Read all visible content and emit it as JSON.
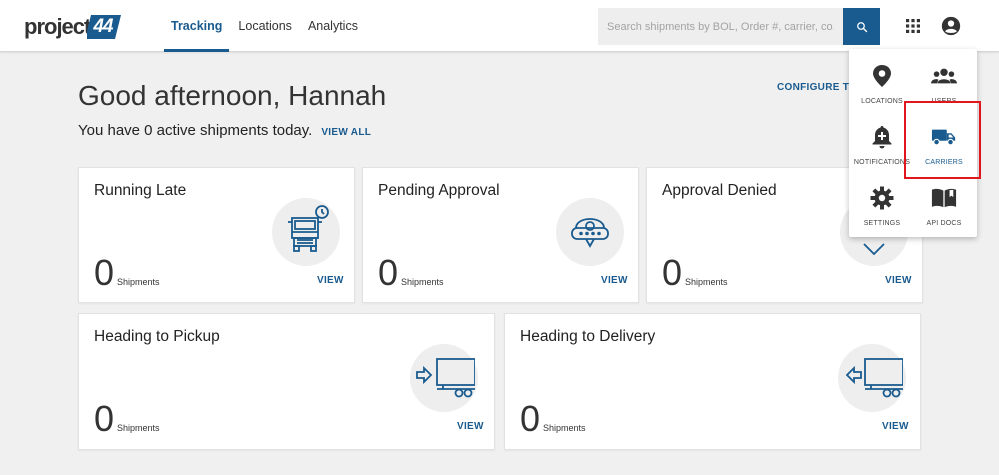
{
  "header": {
    "logo_text": "project",
    "logo_mark": "44",
    "tabs": [
      {
        "label": "Tracking",
        "active": true
      },
      {
        "label": "Locations",
        "active": false
      },
      {
        "label": "Analytics",
        "active": false
      }
    ],
    "search": {
      "placeholder": "Search shipments by BOL, Order #, carrier, co..."
    },
    "icons": {
      "search": "search-icon",
      "apps": "apps-grid-icon",
      "account": "account-icon"
    }
  },
  "main": {
    "greeting": "Good afternoon, Hannah",
    "subline": "You have 0 active shipments today.",
    "view_all": "VIEW ALL",
    "configure": "CONFIGURE TH"
  },
  "cards": [
    {
      "title": "Running Late",
      "count": "0",
      "unit": "Shipments",
      "view": "VIEW",
      "icon": "truck-clock-icon"
    },
    {
      "title": "Pending Approval",
      "count": "0",
      "unit": "Shipments",
      "view": "VIEW",
      "icon": "location-pin-icon"
    },
    {
      "title": "Approval Denied",
      "count": "0",
      "unit": "Shipments",
      "view": "VIEW",
      "icon": "location-denied-icon"
    },
    {
      "title": "Heading to Pickup",
      "count": "0",
      "unit": "Shipments",
      "view": "VIEW",
      "icon": "truck-pickup-icon"
    },
    {
      "title": "Heading to Delivery",
      "count": "0",
      "unit": "Shipments",
      "view": "VIEW",
      "icon": "truck-delivery-icon"
    }
  ],
  "apps_menu": {
    "items": [
      {
        "label": "LOCATIONS",
        "icon": "location-pin-icon"
      },
      {
        "label": "USERS",
        "icon": "users-icon"
      },
      {
        "label": "NOTIFICATIONS",
        "icon": "bell-plus-icon"
      },
      {
        "label": "CARRIERS",
        "icon": "truck-icon",
        "highlighted": true
      },
      {
        "label": "SETTINGS",
        "icon": "gear-icon"
      },
      {
        "label": "API DOCS",
        "icon": "book-icon"
      }
    ]
  },
  "colors": {
    "accent": "#1a5b8f",
    "highlight": "#e0161c",
    "background": "#f0f0f0"
  }
}
